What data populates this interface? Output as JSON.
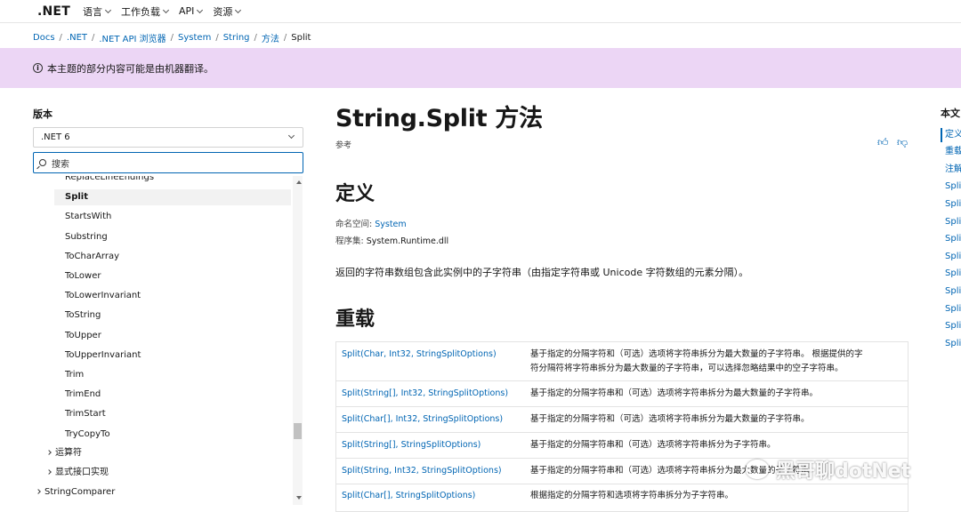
{
  "topnav": {
    "brand": ".NET",
    "items": [
      {
        "label": "语言"
      },
      {
        "label": "工作负载"
      },
      {
        "label": "API"
      },
      {
        "label": "资源"
      }
    ]
  },
  "breadcrumb": [
    "Docs",
    ".NET",
    ".NET API 浏览器",
    "System",
    "String",
    "方法",
    "Split"
  ],
  "banner": {
    "text": "本主题的部分内容可能是由机器翻译。"
  },
  "sidebar": {
    "version_label": "版本",
    "version_value": ".NET 6",
    "search_placeholder": "搜索",
    "partial_item": "ReplaceLineEndings",
    "items": [
      {
        "label": "Split",
        "selected": true
      },
      {
        "label": "StartsWith"
      },
      {
        "label": "Substring"
      },
      {
        "label": "ToCharArray"
      },
      {
        "label": "ToLower"
      },
      {
        "label": "ToLowerInvariant"
      },
      {
        "label": "ToString"
      },
      {
        "label": "ToUpper"
      },
      {
        "label": "ToUpperInvariant"
      },
      {
        "label": "Trim"
      },
      {
        "label": "TrimEnd"
      },
      {
        "label": "TrimStart"
      },
      {
        "label": "TryCopyTo"
      }
    ],
    "groups": [
      {
        "label": "运算符"
      },
      {
        "label": "显式接口实现"
      }
    ],
    "top_item": "StringComparer"
  },
  "main": {
    "title": "String.Split 方法",
    "doc_type": "参考",
    "definition_heading": "定义",
    "namespace_label": "命名空间:",
    "namespace_value": "System",
    "assembly_label": "程序集:",
    "assembly_value": "System.Runtime.dll",
    "summary": "返回的字符串数组包含此实例中的子字符串（由指定字符串或 Unicode 字符数组的元素分隔）。",
    "overloads_heading": "重载",
    "overloads": [
      {
        "signature": "Split(Char, Int32, StringSplitOptions)",
        "description_1": "基于指定的分隔字符和（可选）选项将字符串拆分为最大数量的子字符串。 根据提供的字",
        "description_2": "符分隔符将字符串拆分为最大数量的子字符串，可以选择忽略结果中的空子字符串。"
      },
      {
        "signature": "Split(String[], Int32, StringSplitOptions)",
        "description_1": "基于指定的分隔字符串和（可选）选项将字符串拆分为最大数量的子字符串。"
      },
      {
        "signature": "Split(Char[], Int32, StringSplitOptions)",
        "description_1": "基于指定的分隔字符和（可选）选项将字符串拆分为最大数量的子字符串。"
      },
      {
        "signature": "Split(String[], StringSplitOptions)",
        "description_1": "基于指定的分隔字符串和（可选）选项将字符串拆分为子字符串。"
      },
      {
        "signature": "Split(String, Int32, StringSplitOptions)",
        "description_1": "基于指定的分隔字符串和（可选）选项将字符串拆分为最大数量的子字符串。"
      },
      {
        "signature": "Split(Char[], StringSplitOptions)",
        "description_1": "根据指定的分隔字符和选项将字符串拆分为子字符串。"
      }
    ]
  },
  "right_toc": {
    "title": "本文",
    "items": [
      "定义",
      "重载",
      "注解",
      "Split",
      "Split",
      "Split",
      "Split",
      "Split",
      "Split",
      "Split",
      "Split",
      "Split",
      "Split"
    ]
  },
  "watermark": {
    "text": "黑哥聊dotNet"
  }
}
